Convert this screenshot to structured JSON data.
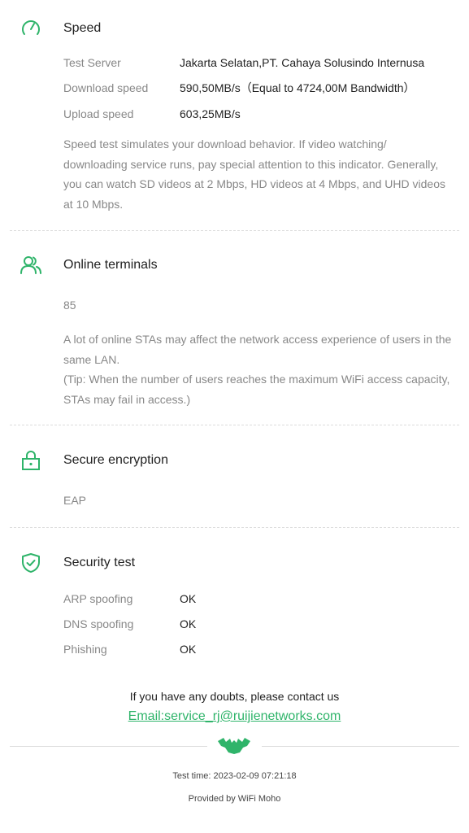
{
  "speed": {
    "title": "Speed",
    "rows": [
      {
        "label": "Test Server",
        "value": "Jakarta Selatan,PT. Cahaya Solusindo Internusa"
      },
      {
        "label": "Download speed",
        "value": "590,50MB/s（Equal to 4724,00M Bandwidth）"
      },
      {
        "label": "Upload speed",
        "value": "603,25MB/s"
      }
    ],
    "description": "Speed test simulates your download behavior. If video watching/ downloading service runs, pay special attention to this indicator. Generally, you can watch SD videos at 2 Mbps, HD videos at 4 Mbps, and UHD videos at 10 Mbps."
  },
  "terminals": {
    "title": "Online terminals",
    "count": "85",
    "description": "A lot of online STAs may affect the network access experience of users in the same LAN.",
    "tip": "(Tip: When the number of users reaches the maximum WiFi access capacity, STAs may fail in access.)"
  },
  "encryption": {
    "title": "Secure encryption",
    "value": "EAP"
  },
  "security": {
    "title": "Security test",
    "rows": [
      {
        "label": "ARP spoofing",
        "value": "OK"
      },
      {
        "label": "DNS spoofing",
        "value": "OK"
      },
      {
        "label": "Phishing",
        "value": "OK"
      }
    ]
  },
  "footer": {
    "contact_text": "If you have any doubts, please contact us",
    "email": "Email:service_rj@ruijienetworks.com",
    "test_time": "Test time: 2023-02-09 07:21:18",
    "provided_by": "Provided by WiFi Moho"
  },
  "colors": {
    "accent": "#2fb46a",
    "label": "#888888",
    "text": "#222222"
  },
  "icons": {
    "speed": "speedometer-icon",
    "terminals": "users-icon",
    "encryption": "lock-icon",
    "security": "shield-check-icon",
    "logo": "bat-logo-icon"
  }
}
